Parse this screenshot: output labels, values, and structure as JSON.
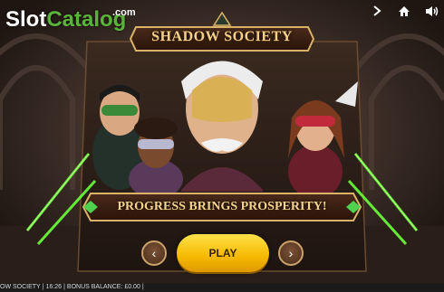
{
  "watermark": {
    "brand_slot": "Slot",
    "brand_catalog": "Catalog",
    "brand_com": ".com"
  },
  "top_icons": [
    "chevron-right-icon",
    "home-icon",
    "speaker-icon"
  ],
  "game": {
    "title": "SHADOW SOCIETY",
    "tagline": "PROGRESS BRINGS PROSPERITY!",
    "play_label": "PLAY",
    "prev_label": "‹",
    "next_label": "›"
  },
  "statusbar": {
    "game_name": "OW SOCIETY",
    "sep1": "|",
    "time": "16:26",
    "sep2": "|",
    "bonus": "BONUS BALANCE: £0.00",
    "sep3": "|"
  },
  "colors": {
    "gold": "#f2d089",
    "play_yellow": "#f5b800",
    "green_glow": "#6bff3a",
    "background": "#2b1f1a"
  }
}
